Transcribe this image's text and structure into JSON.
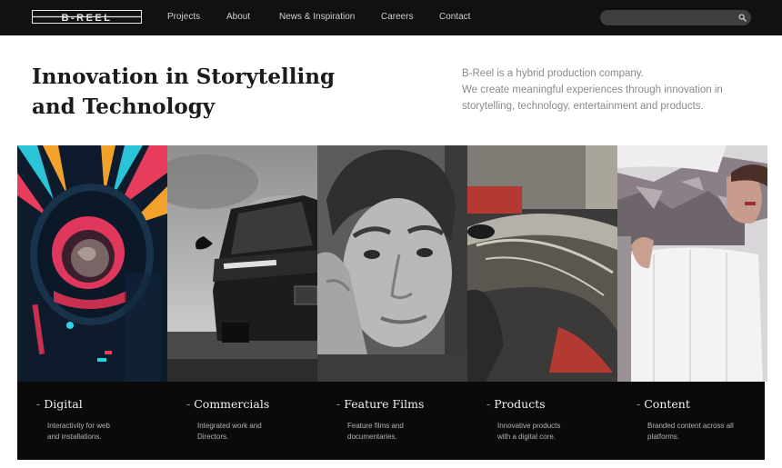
{
  "brand": {
    "logo_text": "B-REEL"
  },
  "nav": {
    "items": [
      {
        "label": "Projects"
      },
      {
        "label": "About"
      },
      {
        "label": "News & Inspiration"
      },
      {
        "label": "Careers"
      },
      {
        "label": "Contact"
      }
    ]
  },
  "search": {
    "placeholder": "",
    "icon": "search-icon"
  },
  "intro": {
    "headline_lines": [
      "Innovation in Storytelling",
      "and Technology"
    ],
    "about_lines": [
      "B-Reel is a hybrid production company.",
      "We create meaningful experiences through innovation in",
      "storytelling, technology, entertainment and products."
    ]
  },
  "categories": [
    {
      "title": "Digital",
      "desc_lines": [
        "Interactivity for web",
        "and installations."
      ],
      "image": "astronaut-illustration"
    },
    {
      "title": "Commercials",
      "desc_lines": [
        "Integrated work and",
        "Directors."
      ],
      "image": "car-photo"
    },
    {
      "title": "Feature Films",
      "desc_lines": [
        "Feature films and",
        "documentaries."
      ],
      "image": "portrait-photo"
    },
    {
      "title": "Products",
      "desc_lines": [
        "Innovative products",
        "with a digital core."
      ],
      "image": "race-track-photo"
    },
    {
      "title": "Content",
      "desc_lines": [
        "Branded content across all",
        "platforms."
      ],
      "image": "fashion-photo"
    }
  ],
  "colors": {
    "topbar": "#111111",
    "caption_bar": "#0a0a0a",
    "headline": "#1b1b1b",
    "body_text": "#8a8a8a"
  }
}
